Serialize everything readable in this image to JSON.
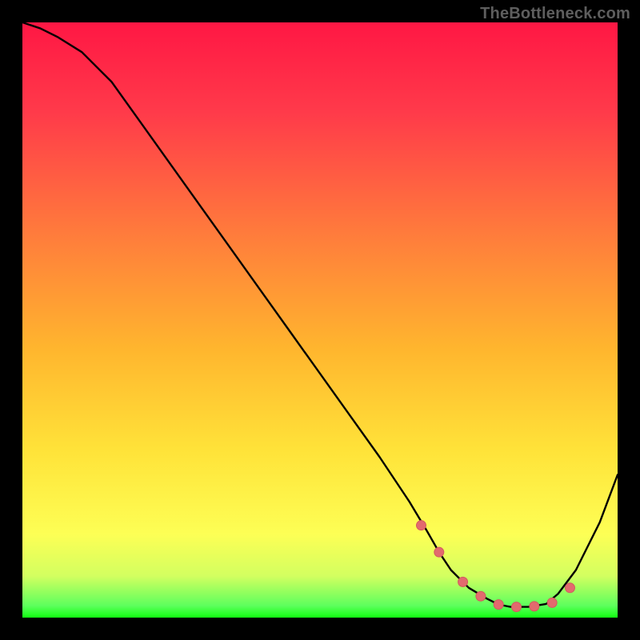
{
  "watermark": "TheBottleneck.com",
  "colors": {
    "curve": "#000000",
    "dot_fill": "#e26a6e",
    "dot_stroke": "#d25a5e",
    "gradient_top": "#ff1744",
    "gradient_mid": "#ffe339",
    "gradient_bottom": "#12ff12"
  },
  "chart_data": {
    "type": "line",
    "title": "",
    "xlabel": "",
    "ylabel": "",
    "xlim": [
      0,
      100
    ],
    "ylim": [
      0,
      100
    ],
    "curve": {
      "name": "bottleneck-curve",
      "x": [
        0,
        3,
        6,
        10,
        15,
        20,
        25,
        30,
        35,
        40,
        45,
        50,
        55,
        60,
        65,
        68,
        70,
        72,
        75,
        78,
        80,
        82,
        85,
        88,
        90,
        93,
        97,
        100
      ],
      "y": [
        100,
        99,
        97.5,
        95,
        90,
        83,
        76,
        69,
        62,
        55,
        48,
        41,
        34,
        27,
        19.5,
        14.5,
        11,
        8,
        5,
        3.2,
        2.2,
        1.8,
        1.8,
        2.3,
        4,
        8,
        16,
        24
      ]
    },
    "dots": {
      "name": "highlighted-points",
      "x": [
        67,
        70,
        74,
        77,
        80,
        83,
        86,
        89,
        92
      ],
      "y": [
        15.5,
        11,
        6,
        3.6,
        2.2,
        1.8,
        1.9,
        2.5,
        5
      ]
    }
  }
}
